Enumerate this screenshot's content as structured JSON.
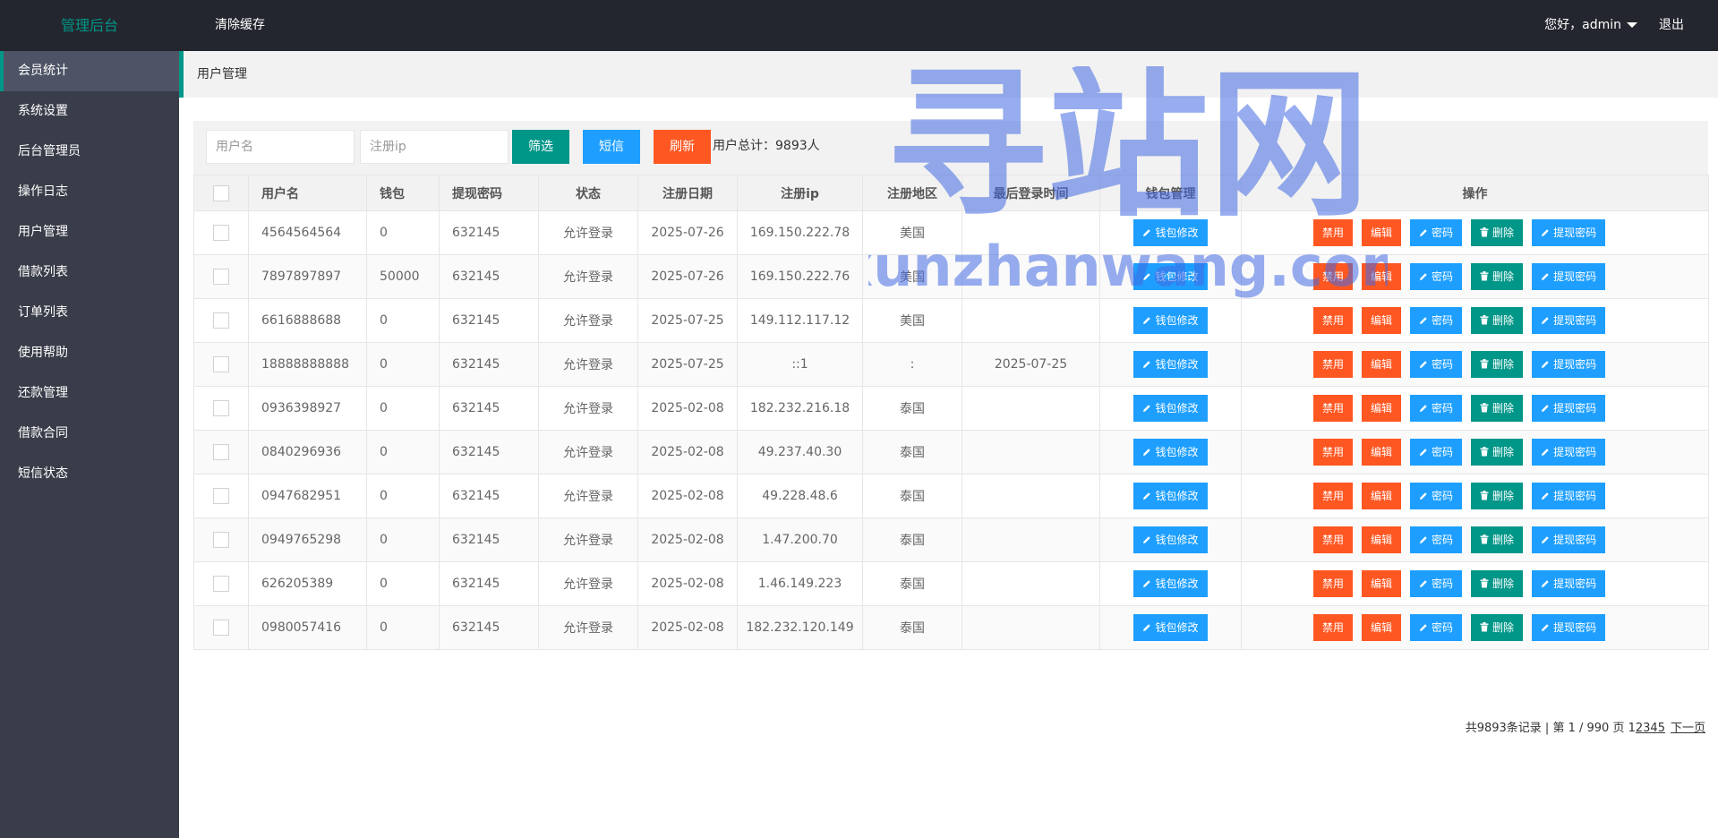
{
  "header": {
    "logo": "管理后台",
    "clear_cache": "清除缓存",
    "greeting": "您好，admin",
    "logout": "退出"
  },
  "sidebar": {
    "items": [
      {
        "label": "会员统计",
        "active": true
      },
      {
        "label": "系统设置"
      },
      {
        "label": "后台管理员"
      },
      {
        "label": "操作日志"
      },
      {
        "label": "用户管理"
      },
      {
        "label": "借款列表"
      },
      {
        "label": "订单列表"
      },
      {
        "label": "使用帮助"
      },
      {
        "label": "还款管理"
      },
      {
        "label": "借款合同"
      },
      {
        "label": "短信状态"
      }
    ]
  },
  "breadcrumb": "用户管理",
  "filter": {
    "username_placeholder": "用户名",
    "ip_placeholder": "注册ip",
    "filter_button": "筛选",
    "sms_button": "短信",
    "refresh_button": "刷新",
    "total": "用户总计：9893人"
  },
  "table": {
    "headers": [
      "用户名",
      "钱包",
      "提现密码",
      "状态",
      "注册日期",
      "注册ip",
      "注册地区",
      "最后登录时间",
      "钱包管理",
      "操作"
    ],
    "wallet_button": "钱包修改",
    "actions": {
      "disable": "禁用",
      "edit": "编辑",
      "password": "密码",
      "delete": "删除",
      "withdraw_password": "提现密码"
    },
    "rows": [
      {
        "username": "4564564564",
        "wallet": "0",
        "withdraw_pwd": "632145",
        "status": "允许登录",
        "reg_date": "2025-07-26",
        "reg_ip": "169.150.222.78",
        "region": "美国",
        "last_login": ""
      },
      {
        "username": "7897897897",
        "wallet": "50000",
        "withdraw_pwd": "632145",
        "status": "允许登录",
        "reg_date": "2025-07-26",
        "reg_ip": "169.150.222.76",
        "region": "美国",
        "last_login": ""
      },
      {
        "username": "6616888688",
        "wallet": "0",
        "withdraw_pwd": "632145",
        "status": "允许登录",
        "reg_date": "2025-07-25",
        "reg_ip": "149.112.117.12",
        "region": "美国",
        "last_login": ""
      },
      {
        "username": "18888888888",
        "wallet": "0",
        "withdraw_pwd": "632145",
        "status": "允许登录",
        "reg_date": "2025-07-25",
        "reg_ip": "::1",
        "region": ":",
        "last_login": "2025-07-25"
      },
      {
        "username": "0936398927",
        "wallet": "0",
        "withdraw_pwd": "632145",
        "status": "允许登录",
        "reg_date": "2025-02-08",
        "reg_ip": "182.232.216.18",
        "region": "泰国",
        "last_login": ""
      },
      {
        "username": "0840296936",
        "wallet": "0",
        "withdraw_pwd": "632145",
        "status": "允许登录",
        "reg_date": "2025-02-08",
        "reg_ip": "49.237.40.30",
        "region": "泰国",
        "last_login": ""
      },
      {
        "username": "0947682951",
        "wallet": "0",
        "withdraw_pwd": "632145",
        "status": "允许登录",
        "reg_date": "2025-02-08",
        "reg_ip": "49.228.48.6",
        "region": "泰国",
        "last_login": ""
      },
      {
        "username": "0949765298",
        "wallet": "0",
        "withdraw_pwd": "632145",
        "status": "允许登录",
        "reg_date": "2025-02-08",
        "reg_ip": "1.47.200.70",
        "region": "泰国",
        "last_login": ""
      },
      {
        "username": "626205389",
        "wallet": "0",
        "withdraw_pwd": "632145",
        "status": "允许登录",
        "reg_date": "2025-02-08",
        "reg_ip": "1.46.149.223",
        "region": "泰国",
        "last_login": ""
      },
      {
        "username": "0980057416",
        "wallet": "0",
        "withdraw_pwd": "632145",
        "status": "允许登录",
        "reg_date": "2025-02-08",
        "reg_ip": "182.232.120.149",
        "region": "泰国",
        "last_login": ""
      }
    ]
  },
  "pagination": {
    "summary": "共9893条记录 | 第 1 / 990 页 1",
    "pages": [
      "2",
      "3",
      "4",
      "5"
    ],
    "next": "下一页"
  },
  "watermark": {
    "title": "寻站网",
    "url": "xunzhanwang.com"
  },
  "colors": {
    "topbar": "#23262e",
    "sidebar": "#393d49",
    "accent_green": "#009688",
    "blue": "#1e9fff",
    "red": "#ff5722"
  }
}
